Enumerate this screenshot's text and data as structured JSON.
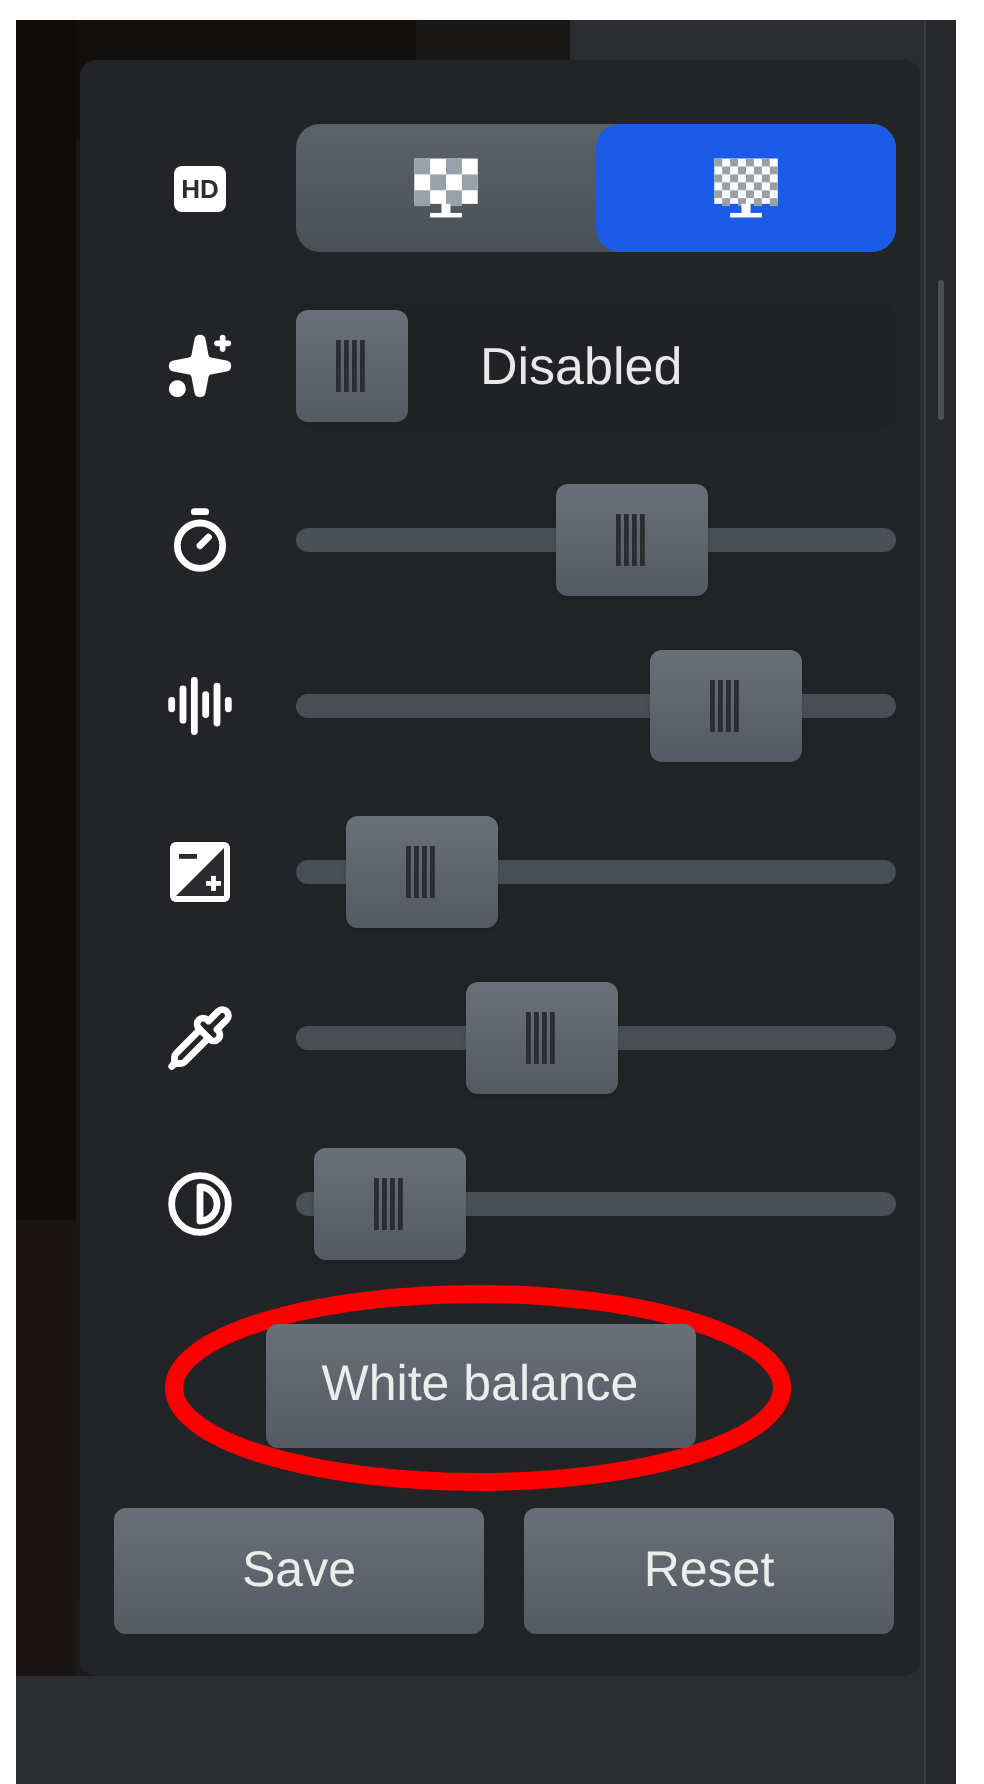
{
  "quality": {
    "badge": "HD",
    "options": [
      {
        "kind": "coarse",
        "selected": false
      },
      {
        "kind": "fine",
        "selected": true
      }
    ]
  },
  "enhance": {
    "on": false,
    "label": "Disabled"
  },
  "sliders": [
    {
      "kind": "timer",
      "level": 0.58
    },
    {
      "kind": "sharpness",
      "level": 0.79
    },
    {
      "kind": "exposure",
      "level": 0.11
    },
    {
      "kind": "color",
      "level": 0.38
    },
    {
      "kind": "contrast",
      "level": 0.04
    }
  ],
  "white_balance": {
    "label": "White balance",
    "highlighted": true
  },
  "buttons": [
    "Save",
    "Reset"
  ]
}
